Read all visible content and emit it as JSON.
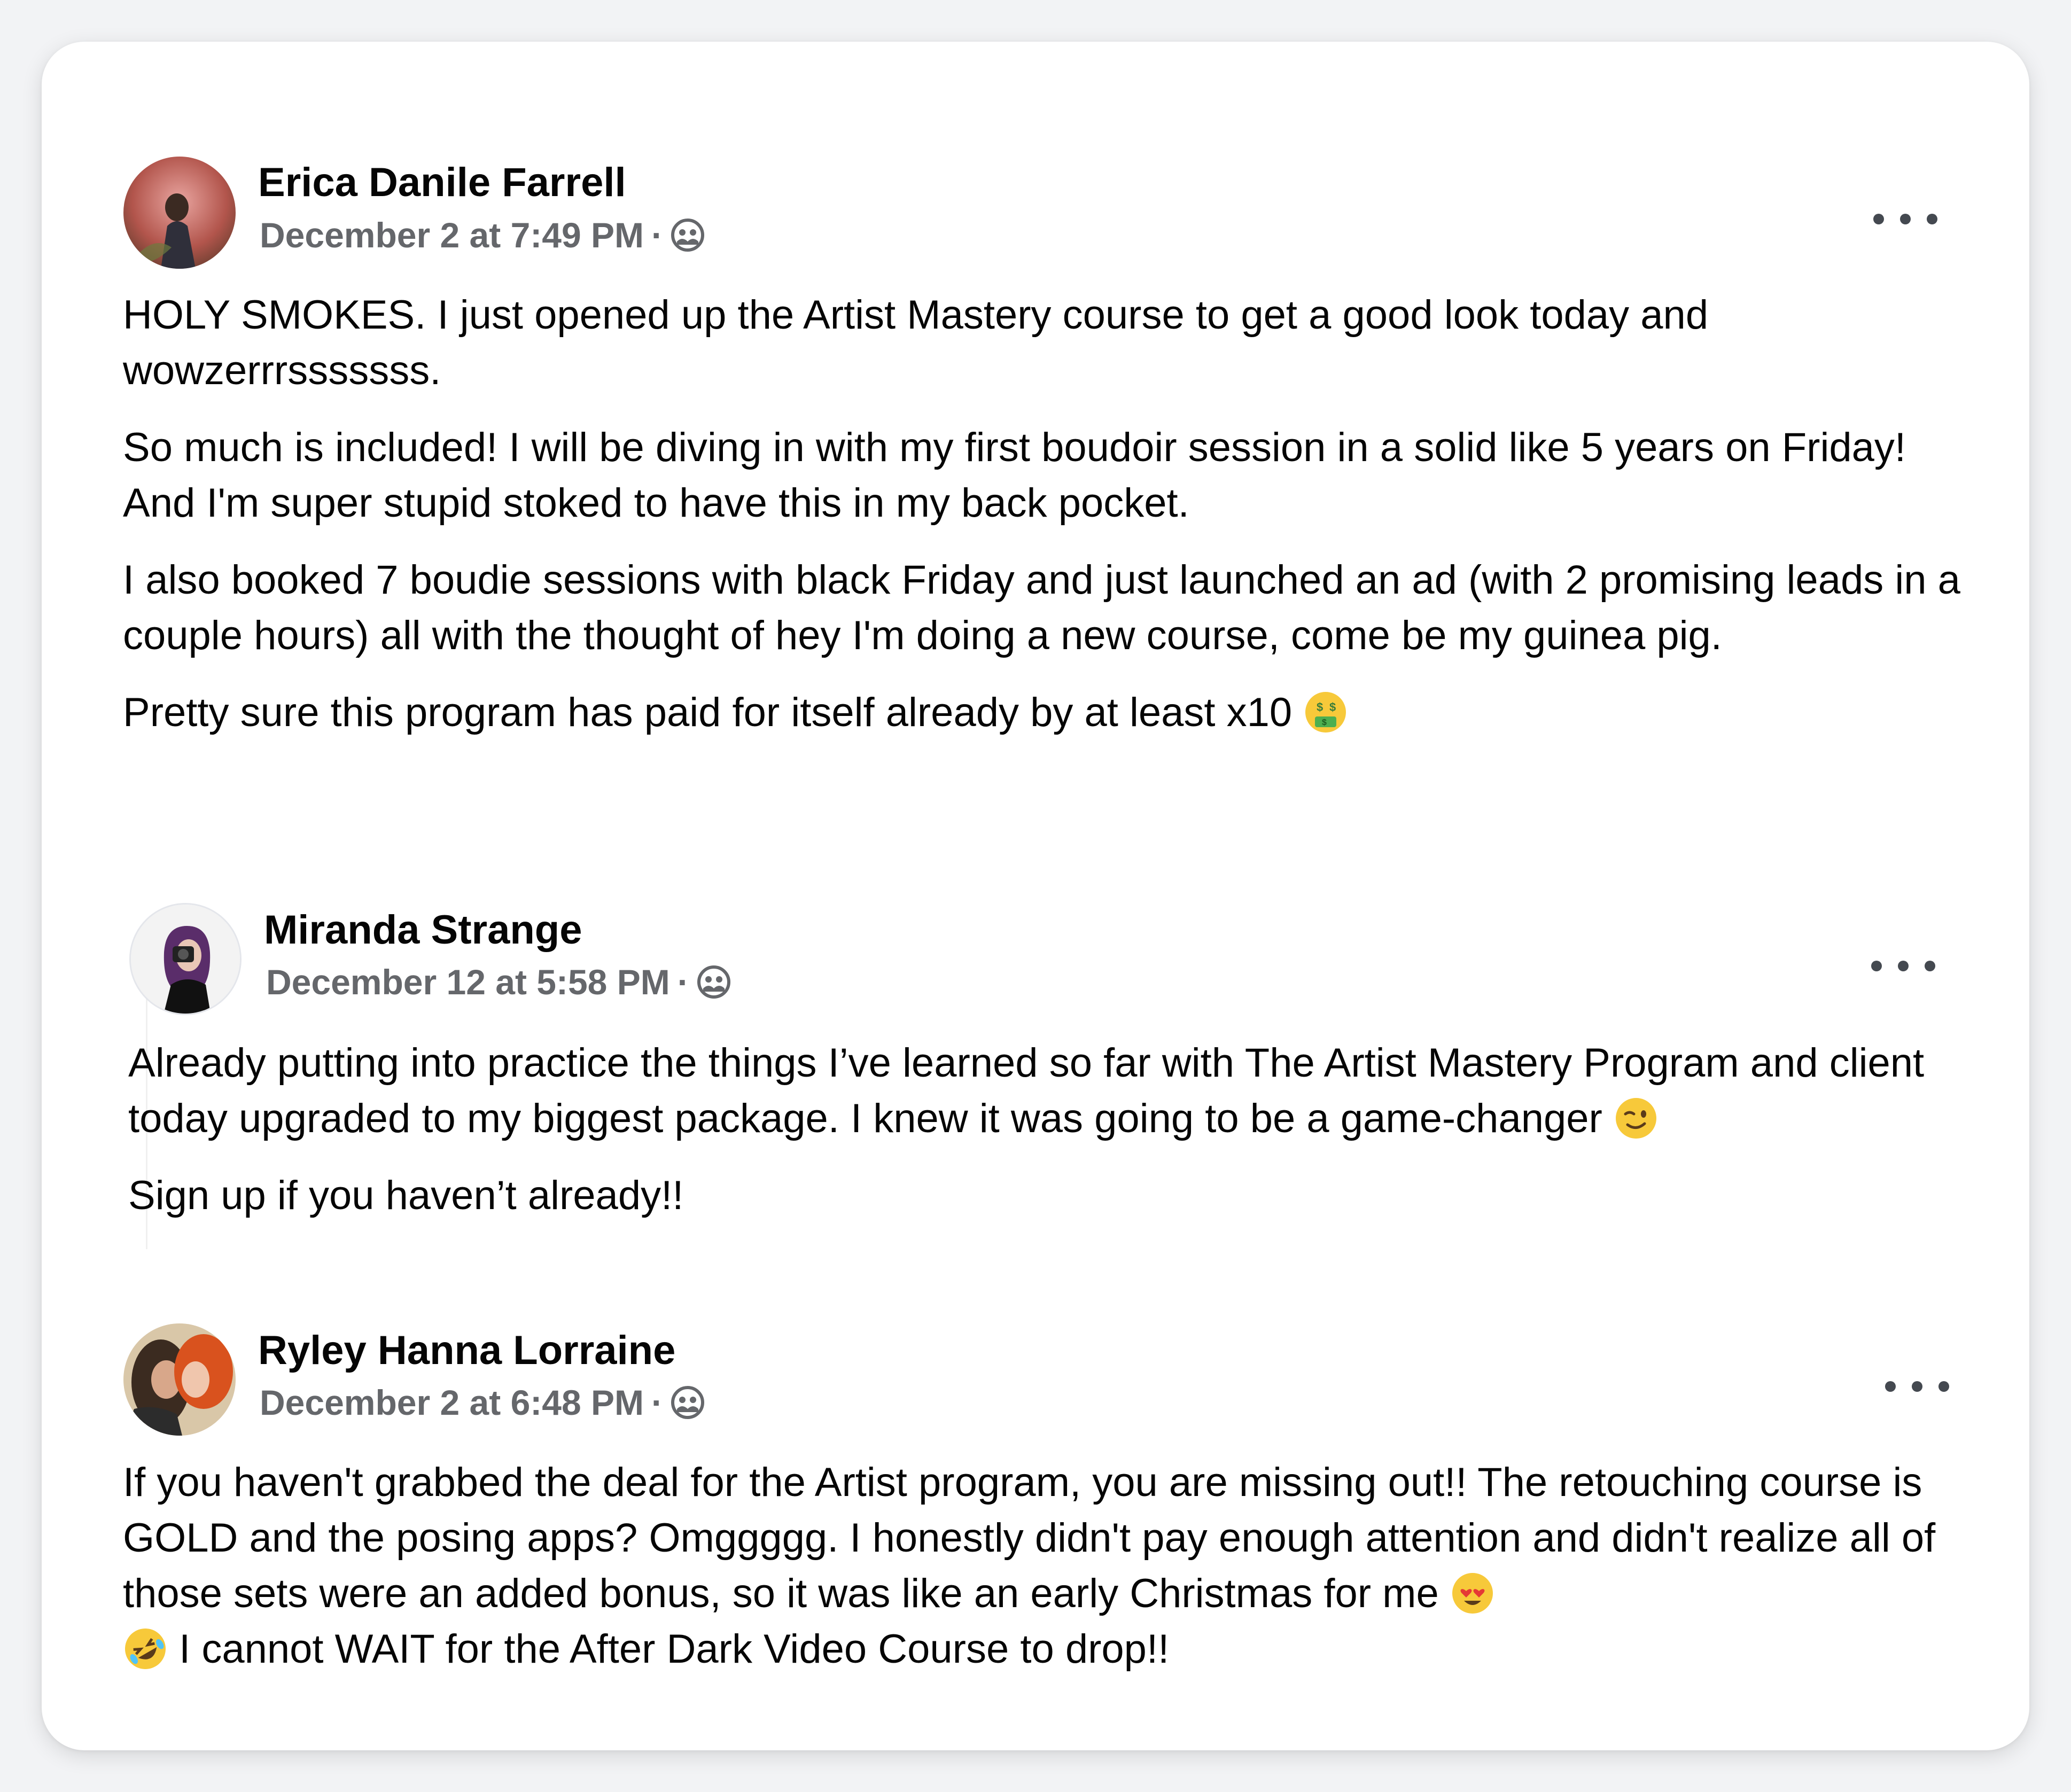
{
  "posts": [
    {
      "author": "Erica Danile Farrell",
      "timestamp": "December 2 at 7:49 PM",
      "separator": "·",
      "privacy_icon": "group-icon",
      "more_icon": "more-options-icon",
      "paragraphs": [
        "HOLY SMOKES. I just opened up the Artist Mastery course to get a good look today and wowzerrrsssssss.",
        "So much is included! I will be diving in with my first boudoir session in a solid like 5 years on Friday! And I'm super stupid stoked to have this in my back pocket.",
        "I also booked 7 boudie sessions with black Friday and just launched an ad (with 2 promising leads in a couple hours) all with the thought of hey I'm doing a new course, come be my guinea pig.",
        "Pretty sure this program has paid for itself already by at least x10"
      ],
      "trailing_emoji": "money-mouth-face"
    },
    {
      "author": "Miranda Strange",
      "timestamp": "December 12 at 5:58 PM",
      "separator": "·",
      "privacy_icon": "group-icon",
      "more_icon": "more-options-icon",
      "paragraphs": [
        "Already putting into practice the things I’ve learned so far with The Artist Mastery Program and client today upgraded to my biggest package. I knew it was going to be a game-changer",
        "Sign up if you haven’t already!!"
      ],
      "trailing_emoji": "winking-face"
    },
    {
      "author": "Ryley Hanna Lorraine",
      "timestamp": "December 2 at 6:48 PM",
      "separator": "·",
      "privacy_icon": "group-icon",
      "more_icon": "more-options-icon",
      "paragraph_part1": "If you haven't grabbed the deal for the Artist program, you are missing out!! The retouching course is GOLD and the posing apps? Omggggg. I honestly didn't pay enough attention and didn't realize all of those sets were an added bonus, so it was like an early Christmas for me",
      "paragraph_part2": "I cannot WAIT for the After Dark Video Course to drop!!",
      "emoji_1": "smiling-face-with-heart-eyes",
      "emoji_2": "rolling-on-the-floor-laughing"
    }
  ]
}
